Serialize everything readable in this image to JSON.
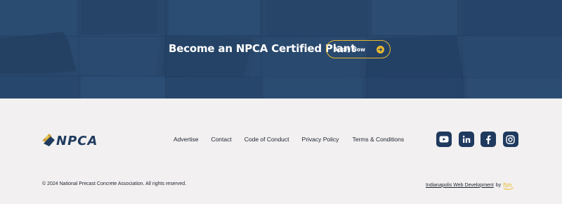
{
  "hero": {
    "title": "Become an NPCA Certified Plant",
    "button_label": "Apply Now",
    "accent_color": "#e9b92e",
    "background_color": "#2d4d72"
  },
  "footer": {
    "logo_text": "NPCA",
    "nav": [
      {
        "label": "Advertise"
      },
      {
        "label": "Contact"
      },
      {
        "label": "Code of Conduct"
      },
      {
        "label": "Privacy Policy"
      },
      {
        "label": "Terms & Conditions"
      }
    ],
    "socials": [
      {
        "icon": "youtube-icon"
      },
      {
        "icon": "linkedin-icon"
      },
      {
        "icon": "facebook-icon"
      },
      {
        "icon": "instagram-icon"
      }
    ],
    "social_color": "#1f3a5e",
    "copyright": "© 2024 National Precast Concrete Association. All rights reserved.",
    "credit_link": "Indianapolis Web Development",
    "credit_by": "by",
    "credit_mark": "fbh"
  }
}
